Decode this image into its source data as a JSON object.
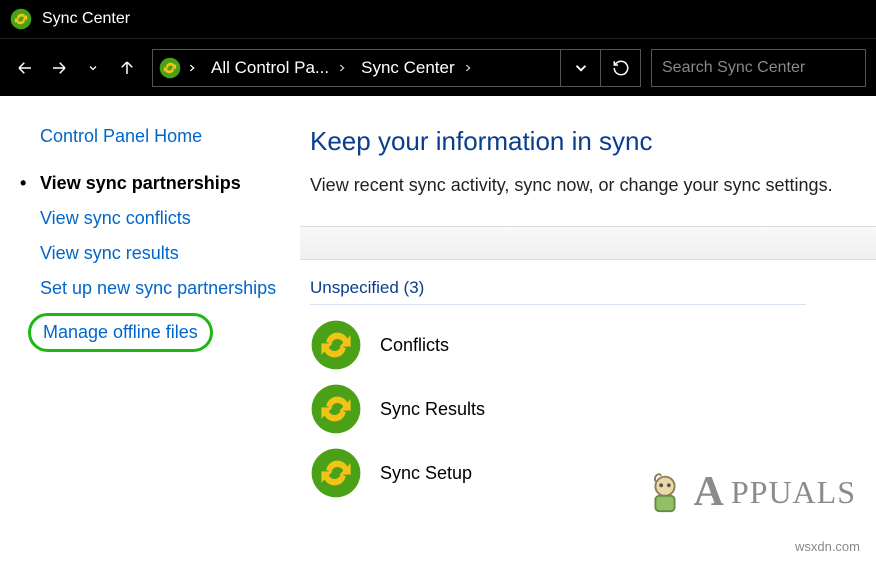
{
  "window": {
    "title": "Sync Center"
  },
  "breadcrumb": {
    "items": [
      {
        "label": "All Control Pa..."
      },
      {
        "label": "Sync Center"
      }
    ]
  },
  "search": {
    "placeholder": "Search Sync Center"
  },
  "sidebar": {
    "home_label": "Control Panel Home",
    "items": [
      {
        "label": "View sync partnerships",
        "active": true
      },
      {
        "label": "View sync conflicts"
      },
      {
        "label": "View sync results"
      },
      {
        "label": "Set up new sync partnerships"
      },
      {
        "label": "Manage offline files",
        "highlight": true
      }
    ]
  },
  "main": {
    "heading": "Keep your information in sync",
    "description": "View recent sync activity, sync now, or change your sync settings.",
    "group_header": "Unspecified (3)",
    "items": [
      {
        "label": "Conflicts"
      },
      {
        "label": "Sync Results"
      },
      {
        "label": "Sync Setup"
      }
    ]
  },
  "watermark": {
    "text": "PPUALS"
  },
  "attribution": "wsxdn.com"
}
